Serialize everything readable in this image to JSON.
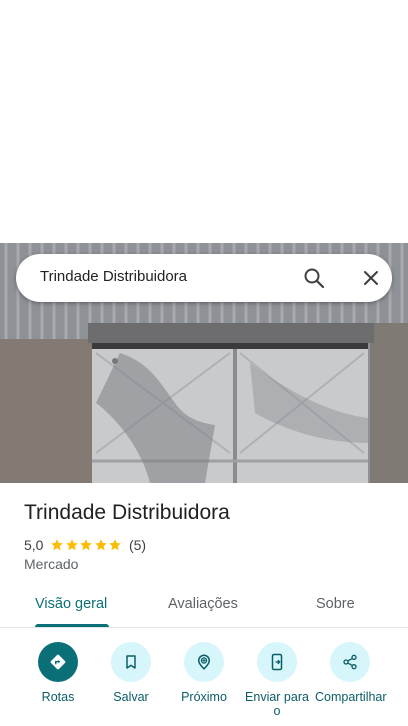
{
  "search": {
    "query": "Trindade Distribuidora",
    "search_icon": "search-icon",
    "close_icon": "close-icon"
  },
  "photo": {
    "description_icon": "storefront-photo"
  },
  "place": {
    "name": "Trindade Distribuidora",
    "rating": "5,0",
    "stars": 5,
    "review_count": "(5)",
    "category": "Mercado"
  },
  "tabs": [
    {
      "label": "Visão geral",
      "active": true
    },
    {
      "label": "Avaliações",
      "active": false
    },
    {
      "label": "Sobre",
      "active": false
    }
  ],
  "actions": [
    {
      "label": "Rotas",
      "icon": "directions-icon"
    },
    {
      "label": "Salvar",
      "icon": "bookmark-icon"
    },
    {
      "label": "Próximo",
      "icon": "nearby-icon"
    },
    {
      "label": "Enviar para o",
      "icon": "send-to-phone-icon"
    },
    {
      "label": "Compartilhar",
      "icon": "share-icon"
    }
  ],
  "colors": {
    "accent": "#0b6f78",
    "action_bg": "#d6f6fc",
    "star": "#fbbc04"
  }
}
